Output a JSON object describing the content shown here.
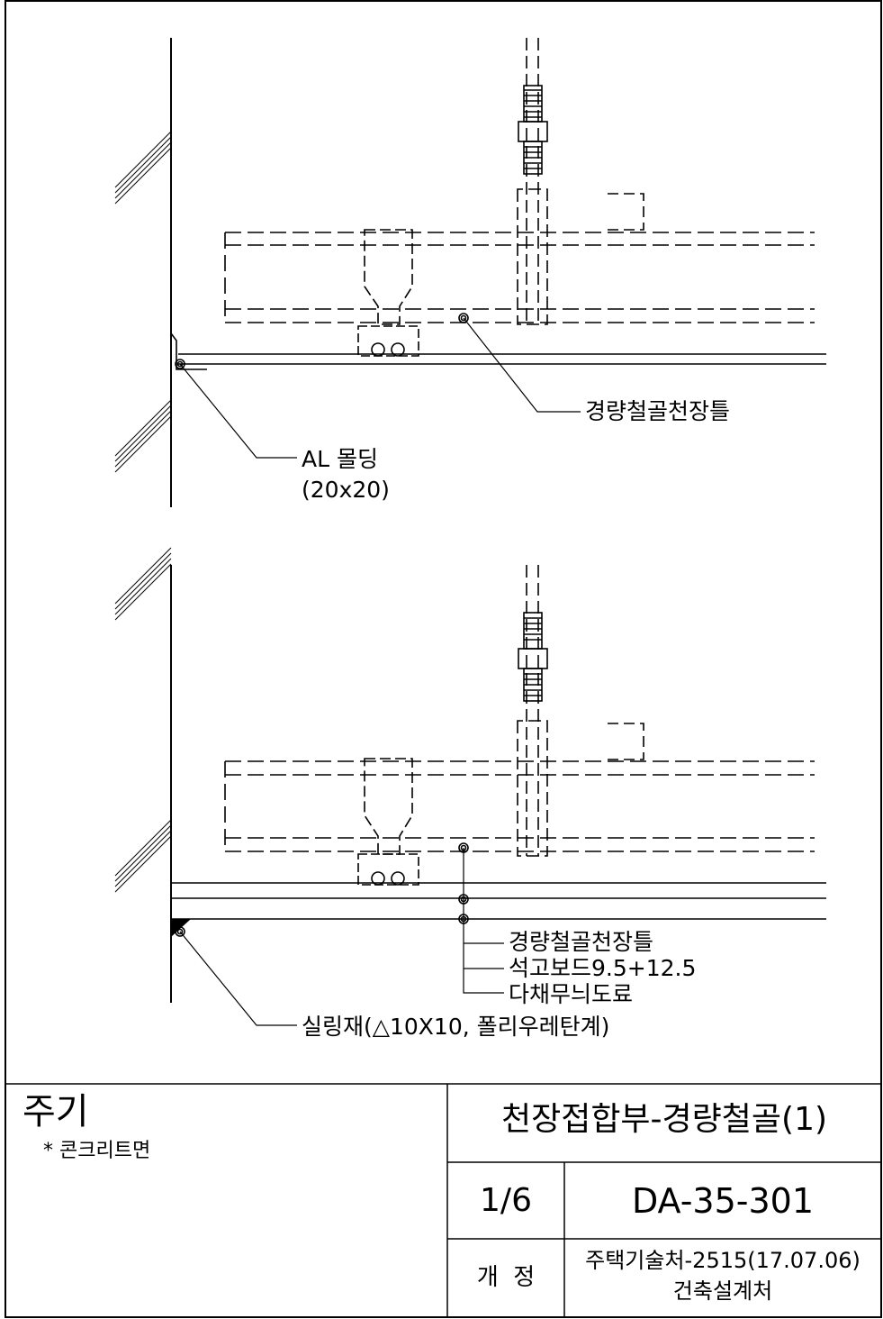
{
  "upper_detail": {
    "label_frame": "경량철골천장틀",
    "label_molding": "AL 몰딩",
    "label_molding_size": "(20x20)"
  },
  "lower_detail": {
    "label_frame": "경량철골천장틀",
    "label_board": "석고보드9.5+12.5",
    "label_finish": "다채무늬도료",
    "label_sealant": "실링재(△10X10, 폴리우레탄계)"
  },
  "title_block": {
    "notes_title": "주기",
    "note_1": "* 콘크리트면",
    "drawing_title": "천장접합부-경량철골(1)",
    "sheet": "1/6",
    "drawing_number": "DA-35-301",
    "revision_label": "개  정",
    "revision_line1": "주택기술처-2515(17.07.06)",
    "revision_line2": "건축설계처"
  }
}
